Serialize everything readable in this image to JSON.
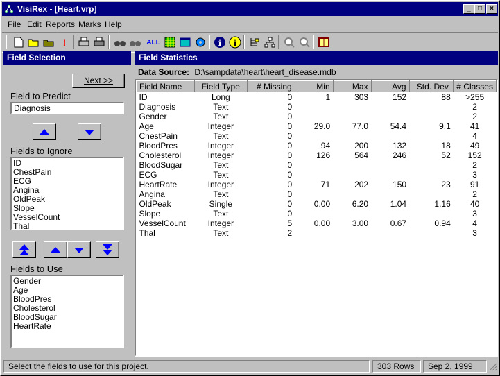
{
  "window": {
    "title": "VisiRex - [Heart.vrp]"
  },
  "menu": [
    "File",
    "Edit",
    "Reports",
    "Marks",
    "Help"
  ],
  "left": {
    "header": "Field Selection",
    "next_label": "Next >>",
    "predict_label": "Field to Predict",
    "predict_value": "Diagnosis",
    "ignore_label": "Fields to Ignore",
    "ignore_items": [
      "ID",
      "ChestPain",
      "ECG",
      "Angina",
      "OldPeak",
      "Slope",
      "VesselCount",
      "Thal"
    ],
    "use_label": "Fields to Use",
    "use_items": [
      "Gender",
      "Age",
      "BloodPres",
      "Cholesterol",
      "BloodSugar",
      "HeartRate"
    ]
  },
  "right": {
    "header": "Field Statistics",
    "ds_label": "Data Source:",
    "ds_path": "D:\\sampdata\\heart\\heart_disease.mdb",
    "columns": [
      "Field Name",
      "Field Type",
      "# Missing",
      "Min",
      "Max",
      "Avg",
      "Std. Dev.",
      "# Classes"
    ],
    "rows": [
      [
        "ID",
        "Long",
        "0",
        "1",
        "303",
        "152",
        "88",
        ">255"
      ],
      [
        "Diagnosis",
        "Text",
        "0",
        "",
        "",
        "",
        "",
        "2"
      ],
      [
        "Gender",
        "Text",
        "0",
        "",
        "",
        "",
        "",
        "2"
      ],
      [
        "Age",
        "Integer",
        "0",
        "29.0",
        "77.0",
        "54.4",
        "9.1",
        "41"
      ],
      [
        "ChestPain",
        "Text",
        "0",
        "",
        "",
        "",
        "",
        "4"
      ],
      [
        "BloodPres",
        "Integer",
        "0",
        "94",
        "200",
        "132",
        "18",
        "49"
      ],
      [
        "Cholesterol",
        "Integer",
        "0",
        "126",
        "564",
        "246",
        "52",
        "152"
      ],
      [
        "BloodSugar",
        "Text",
        "0",
        "",
        "",
        "",
        "",
        "2"
      ],
      [
        "ECG",
        "Text",
        "0",
        "",
        "",
        "",
        "",
        "3"
      ],
      [
        "HeartRate",
        "Integer",
        "0",
        "71",
        "202",
        "150",
        "23",
        "91"
      ],
      [
        "Angina",
        "Text",
        "0",
        "",
        "",
        "",
        "",
        "2"
      ],
      [
        "OldPeak",
        "Single",
        "0",
        "0.00",
        "6.20",
        "1.04",
        "1.16",
        "40"
      ],
      [
        "Slope",
        "Text",
        "0",
        "",
        "",
        "",
        "",
        "3"
      ],
      [
        "VesselCount",
        "Integer",
        "5",
        "0.00",
        "3.00",
        "0.67",
        "0.94",
        "4"
      ],
      [
        "Thal",
        "Text",
        "2",
        "",
        "",
        "",
        "",
        "3"
      ]
    ]
  },
  "status": {
    "message": "Select the fields to use for this project.",
    "rows": "303 Rows",
    "date": "Sep 2, 1999"
  },
  "toolbar_icons": [
    "new-icon",
    "open-icon",
    "save-open-icon",
    "exclamation-icon",
    "print-icon",
    "print-preview-icon",
    "binoculars-icon",
    "binoculars-multi-icon",
    "all-icon",
    "grid-icon",
    "window-icon",
    "gear-icon",
    "info-icon",
    "info-yellow-icon",
    "tree-icon",
    "tree-branch-icon",
    "zoom-in-icon",
    "zoom-out-icon",
    "book-icon"
  ]
}
